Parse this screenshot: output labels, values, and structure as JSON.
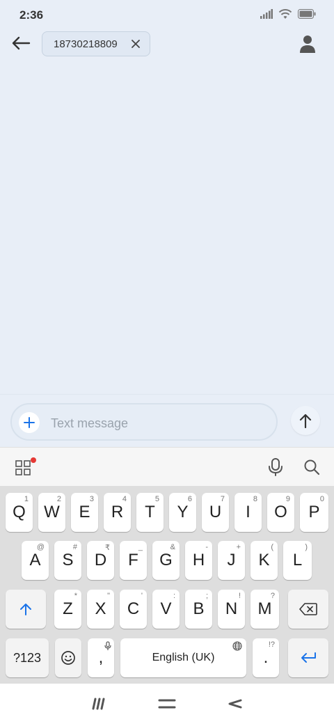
{
  "status_bar": {
    "time": "2:36",
    "icons": [
      "signal-icon",
      "wifi-icon",
      "battery-icon"
    ]
  },
  "header": {
    "back_icon": "arrow-left-icon",
    "recipient": "18730218809",
    "chip_remove_icon": "close-icon",
    "contact_icon": "person-icon"
  },
  "compose": {
    "add_icon": "plus-icon",
    "placeholder": "Text message",
    "send_icon": "arrow-up-icon"
  },
  "keyboard_toolbar": {
    "icons": [
      "apps-grid-icon",
      "microphone-icon",
      "search-icon"
    ],
    "badge_color": "#e53935"
  },
  "keyboard": {
    "row1": [
      {
        "label": "Q",
        "hint": "1"
      },
      {
        "label": "W",
        "hint": "2"
      },
      {
        "label": "E",
        "hint": "3"
      },
      {
        "label": "R",
        "hint": "4"
      },
      {
        "label": "T",
        "hint": "5"
      },
      {
        "label": "Y",
        "hint": "6"
      },
      {
        "label": "U",
        "hint": "7"
      },
      {
        "label": "I",
        "hint": "8"
      },
      {
        "label": "O",
        "hint": "9"
      },
      {
        "label": "P",
        "hint": "0"
      }
    ],
    "row2": [
      {
        "label": "A",
        "hint": "@"
      },
      {
        "label": "S",
        "hint": "#"
      },
      {
        "label": "D",
        "hint": "₹"
      },
      {
        "label": "F",
        "hint": "_"
      },
      {
        "label": "G",
        "hint": "&"
      },
      {
        "label": "H",
        "hint": "-"
      },
      {
        "label": "J",
        "hint": "+"
      },
      {
        "label": "K",
        "hint": "("
      },
      {
        "label": "L",
        "hint": ")"
      }
    ],
    "row3": [
      {
        "label": "Z",
        "hint": "*"
      },
      {
        "label": "X",
        "hint": "\""
      },
      {
        "label": "C",
        "hint": "'"
      },
      {
        "label": "V",
        "hint": ":"
      },
      {
        "label": "B",
        "hint": ";"
      },
      {
        "label": "N",
        "hint": "!"
      },
      {
        "label": "M",
        "hint": "?"
      }
    ],
    "shift_icon": "shift-arrow-icon",
    "backspace_icon": "backspace-icon",
    "symbols_label": "?123",
    "emoji_icon": "emoji-icon",
    "comma_label": ",",
    "space_label": "English (UK)",
    "period_label": ".",
    "period_hint": "!?",
    "enter_icon": "enter-icon",
    "accent_color": "#1a73e8"
  },
  "nav_bar": {
    "icons": [
      "recents-icon",
      "home-icon",
      "back-icon"
    ]
  }
}
